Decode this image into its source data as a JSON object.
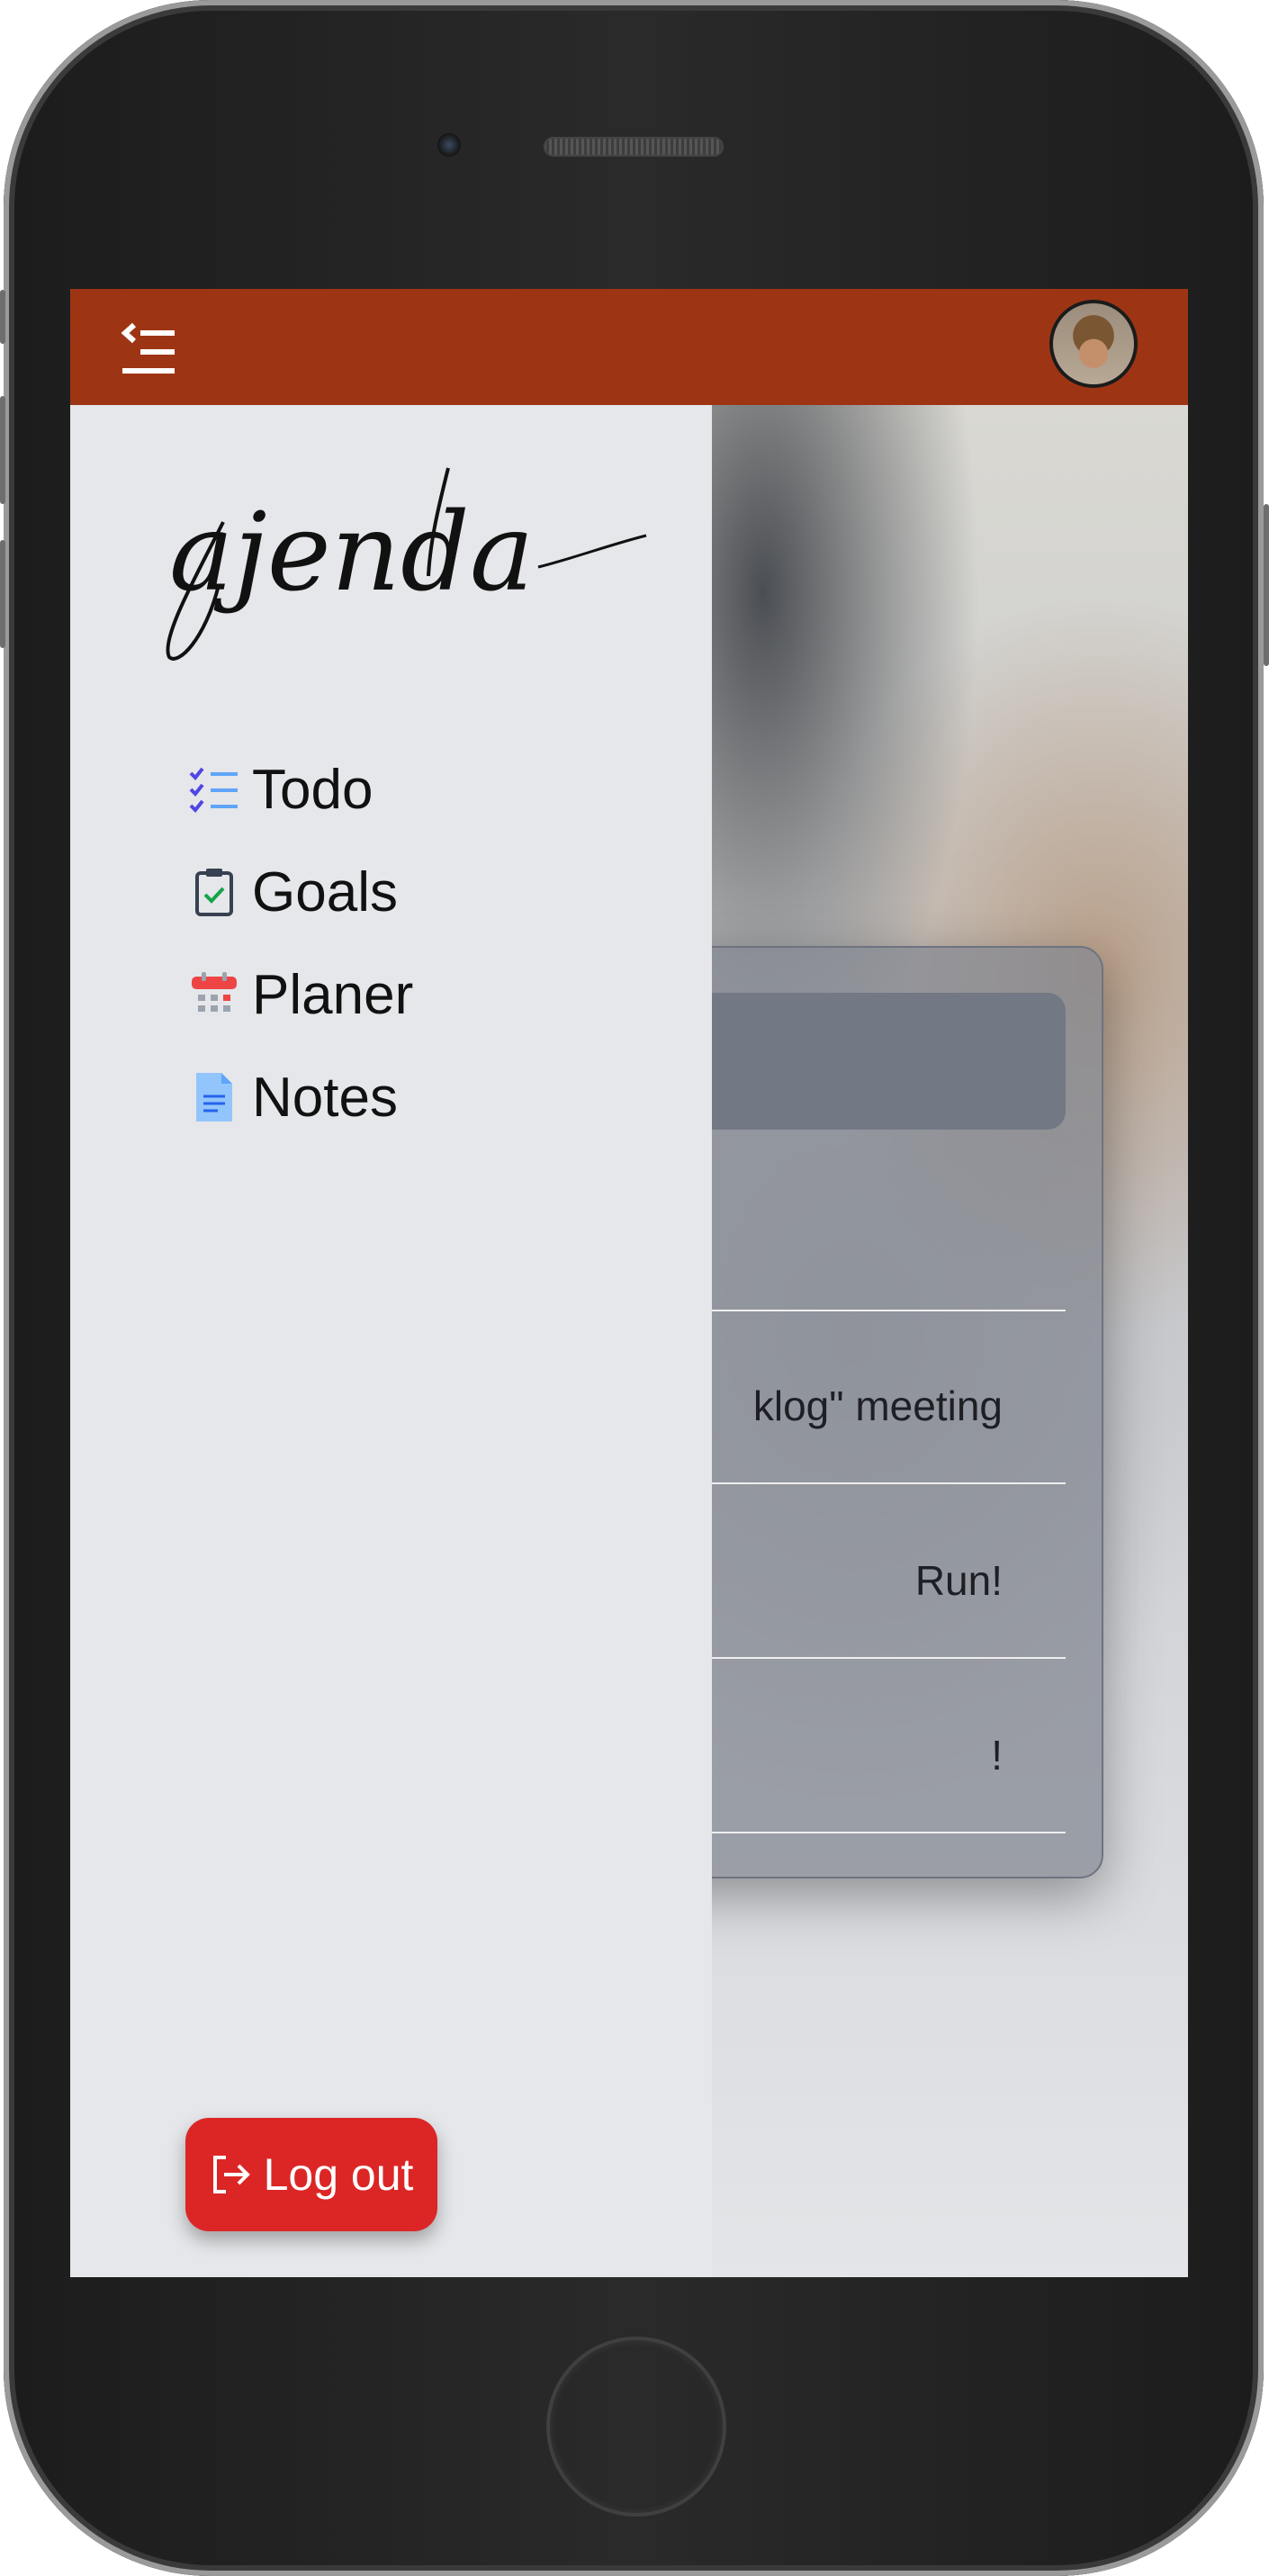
{
  "app": {
    "name": "ajenda"
  },
  "header": {
    "menu_icon": "sidebar-collapse-icon",
    "avatar_icon": "user-avatar"
  },
  "drawer": {
    "items": [
      {
        "label": "Todo",
        "icon": "checklist-icon"
      },
      {
        "label": "Goals",
        "icon": "clipboard-check-icon"
      },
      {
        "label": "Planer",
        "icon": "calendar-icon"
      },
      {
        "label": "Notes",
        "icon": "document-icon"
      }
    ],
    "logout_label": "Log out"
  },
  "todo": {
    "input_placeholder": "",
    "items": [
      {
        "text": ""
      },
      {
        "text": "klog\" meeting"
      },
      {
        "text": "Run!"
      },
      {
        "text": "!"
      }
    ]
  },
  "colors": {
    "topbar": "#9d3515",
    "logout": "#dc2626",
    "drawer": "#e5e7ea"
  }
}
